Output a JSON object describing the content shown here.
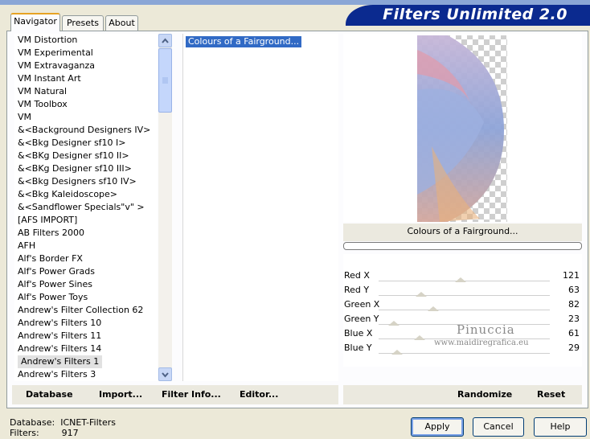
{
  "header": {
    "title": "Filters Unlimited 2.0"
  },
  "tabs": [
    {
      "label": "Navigator"
    },
    {
      "label": "Presets"
    },
    {
      "label": "About"
    }
  ],
  "categories": [
    "VM Distortion",
    "VM Experimental",
    "VM Extravaganza",
    "VM Instant Art",
    "VM Natural",
    "VM Toolbox",
    "VM",
    "&<Background Designers IV>",
    "&<Bkg Designer sf10 I>",
    "&<BKg Designer sf10 II>",
    "&<BKg Designer sf10 III>",
    "&<Bkg Designers sf10 IV>",
    "&<Bkg Kaleidoscope>",
    "&<Sandflower Specials\"v\" >",
    "[AFS IMPORT]",
    "AB Filters 2000",
    "AFH",
    "Alf's Border FX",
    "Alf's Power Grads",
    "Alf's Power Sines",
    "Alf's Power Toys",
    "Andrew's Filter Collection 62",
    "Andrew's Filters 10",
    "Andrew's Filters 11",
    "Andrew's Filters 14",
    "Andrew's Filters 1",
    "Andrew's Filters 3"
  ],
  "selected_category": "Andrew's Filters 1",
  "selected_filter": "Colours of a Fairground...",
  "preview_caption": "Colours of a Fairground...",
  "sliders": [
    {
      "label": "Red X",
      "value": "121",
      "level": 0.48
    },
    {
      "label": "Red Y",
      "value": "63",
      "level": 0.25
    },
    {
      "label": "Green X",
      "value": "82",
      "level": 0.32
    },
    {
      "label": "Green Y",
      "value": "23",
      "level": 0.09
    },
    {
      "label": "Blue X",
      "value": "61",
      "level": 0.24
    },
    {
      "label": "Blue Y",
      "value": "29",
      "level": 0.11
    }
  ],
  "watermark": {
    "name": "Pinuccia",
    "url": "www.maidiregrafica.eu"
  },
  "left_buttons": {
    "database": "Database",
    "import": "Import...",
    "filter_info": "Filter Info...",
    "editor": "Editor..."
  },
  "right_buttons": {
    "randomize": "Randomize",
    "reset": "Reset"
  },
  "status": {
    "database_label": "Database:",
    "database_value": "ICNET-Filters",
    "filters_label": "Filters:",
    "filters_value": "917"
  },
  "dialog_buttons": {
    "apply": "Apply",
    "cancel": "Cancel",
    "help": "Help"
  },
  "colors": {
    "brand": "#0b2a8f",
    "selection": "#316ac5",
    "tab_accent": "#e6a324"
  }
}
